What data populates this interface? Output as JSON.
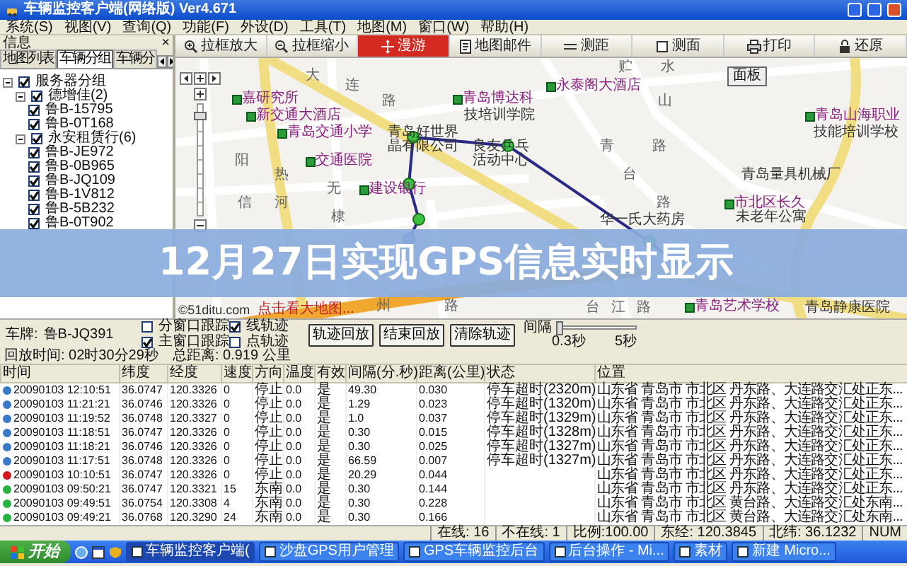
{
  "window": {
    "title": "车辆监控客户端(网络版) Ver4.671"
  },
  "menu": [
    "系统(S)",
    "视图(V)",
    "查询(Q)",
    "功能(F)",
    "外设(D)",
    "工具(T)",
    "地图(M)",
    "窗口(W)",
    "帮助(H)"
  ],
  "info_panel": {
    "title": "信息",
    "close": "×",
    "tabs": [
      {
        "label": "地图列表",
        "selected": false
      },
      {
        "label": "车辆分组",
        "selected": true
      },
      {
        "label": "车辆分",
        "selected": false
      }
    ],
    "tree": [
      {
        "label": "服务器分组",
        "checked": true,
        "expanded": true,
        "children": [
          {
            "label": "德增佳(2)",
            "checked": true,
            "expanded": true,
            "children": [
              {
                "label": "鲁B-15795",
                "checked": true
              },
              {
                "label": "鲁B-0T168",
                "checked": true
              }
            ]
          },
          {
            "label": "永安租赁行(6)",
            "checked": true,
            "expanded": true,
            "children": [
              {
                "label": "鲁B-JE972",
                "checked": true
              },
              {
                "label": "鲁B-0B965",
                "checked": true
              },
              {
                "label": "鲁B-JQ109",
                "checked": true
              },
              {
                "label": "鲁B-1V812",
                "checked": true
              },
              {
                "label": "鲁B-5B232",
                "checked": true
              },
              {
                "label": "鲁B-0T902",
                "checked": true
              }
            ]
          }
        ]
      }
    ]
  },
  "map": {
    "toolbar": [
      {
        "label": "拉框放大",
        "selected": false
      },
      {
        "label": "拉框缩小",
        "selected": false
      },
      {
        "label": "漫游",
        "selected": true
      },
      {
        "label": "地图邮件",
        "selected": false
      },
      {
        "label": "测距",
        "selected": false
      },
      {
        "label": "测面",
        "selected": false
      },
      {
        "label": "打印",
        "selected": false
      },
      {
        "label": "还原",
        "selected": false
      }
    ],
    "panel_button": "面板",
    "labels": [
      {
        "text": "贮",
        "kind": "road"
      },
      {
        "text": "水",
        "kind": "road"
      },
      {
        "text": "大",
        "kind": "road"
      },
      {
        "text": "连",
        "kind": "road"
      },
      {
        "text": "永泰阁大酒店",
        "kind": "poi"
      },
      {
        "text": "嘉研究所",
        "kind": "poi"
      },
      {
        "text": "路",
        "kind": "road"
      },
      {
        "text": "青岛博达科",
        "kind": "poi"
      },
      {
        "text": "山",
        "kind": "road"
      },
      {
        "text": "新交通大酒店",
        "kind": "poi"
      },
      {
        "text": "技培训学院",
        "kind": "text"
      },
      {
        "text": "青岛山海职业",
        "kind": "poi"
      },
      {
        "text": "青岛交通小学",
        "kind": "poi"
      },
      {
        "text": "青岛好世界",
        "kind": "text"
      },
      {
        "text": "技能培训学校",
        "kind": "text"
      },
      {
        "text": "晶有限公司",
        "kind": "text"
      },
      {
        "text": "良友乒乓",
        "kind": "text"
      },
      {
        "text": "青",
        "kind": "road"
      },
      {
        "text": "路",
        "kind": "road"
      },
      {
        "text": "阳",
        "kind": "road"
      },
      {
        "text": "交通医院",
        "kind": "poi"
      },
      {
        "text": "活动中心",
        "kind": "text"
      },
      {
        "text": "热",
        "kind": "road"
      },
      {
        "text": "台",
        "kind": "road"
      },
      {
        "text": "青岛量具机械厂",
        "kind": "text"
      },
      {
        "text": "无",
        "kind": "road"
      },
      {
        "text": "建设银行",
        "kind": "poi"
      },
      {
        "text": "信",
        "kind": "road"
      },
      {
        "text": "河",
        "kind": "road"
      },
      {
        "text": "路",
        "kind": "road"
      },
      {
        "text": "市北区长久",
        "kind": "poi"
      },
      {
        "text": "棣",
        "kind": "road"
      },
      {
        "text": "华一氏大药房",
        "kind": "text"
      },
      {
        "text": "未老年公寓",
        "kind": "text"
      },
      {
        "text": "州",
        "kind": "road"
      },
      {
        "text": "路",
        "kind": "road"
      },
      {
        "text": "台",
        "kind": "road"
      },
      {
        "text": "江",
        "kind": "road"
      },
      {
        "text": "路",
        "kind": "road"
      },
      {
        "text": "青岛艺术学校",
        "kind": "poi"
      },
      {
        "text": "青岛静康医院",
        "kind": "text"
      }
    ],
    "copyright": "©51ditu.com",
    "big_map_link": "点击看大地图..."
  },
  "playback": {
    "plate_label": "车牌:",
    "plate": "鲁B-JQ391",
    "options": [
      {
        "label": "分窗口跟踪",
        "checked": false
      },
      {
        "label": "线轨迹",
        "checked": true
      },
      {
        "label": "主窗口跟踪",
        "checked": true
      },
      {
        "label": "点轨迹",
        "checked": false
      }
    ],
    "buttons": [
      "轨迹回放",
      "结束回放",
      "清除轨迹"
    ],
    "interval": {
      "label": "间隔",
      "level": 0,
      "min": "0.3秒",
      "max": "5秒"
    }
  },
  "summary": [
    "回放时间: 02时30分29秒",
    "总距离: 0.919 公里"
  ],
  "table": {
    "columns": [
      "时间",
      "纬度",
      "经度",
      "速度",
      "方向",
      "温度",
      "有效",
      "间隔(分.秒)",
      "距离(公里)",
      "状态",
      "位置"
    ],
    "rows": [
      {
        "color": "#3a78c8",
        "cells": [
          "20090103 12:10:51",
          "36.0747",
          "120.3326",
          "0",
          "停止",
          "0.0",
          "是",
          "49.30",
          "0.030",
          "停车超时(2320m)",
          "山东省 青岛市 市北区 丹东路、大连路交汇处正东..."
        ]
      },
      {
        "color": "#3a78c8",
        "cells": [
          "20090103 11:21:21",
          "36.0746",
          "120.3326",
          "0",
          "停止",
          "0.0",
          "是",
          "1.29",
          "0.023",
          "停车超时(1320m)",
          "山东省 青岛市 市北区 丹东路、大连路交汇处正东..."
        ]
      },
      {
        "color": "#3a78c8",
        "cells": [
          "20090103 11:19:52",
          "36.0748",
          "120.3327",
          "0",
          "停止",
          "0.0",
          "是",
          "1.0",
          "0.037",
          "停车超时(1329m)",
          "山东省 青岛市 市北区 丹东路、大连路交汇处正东..."
        ]
      },
      {
        "color": "#3a78c8",
        "cells": [
          "20090103 11:18:51",
          "36.0747",
          "120.3326",
          "0",
          "停止",
          "0.0",
          "是",
          "0.30",
          "0.015",
          "停车超时(1328m)",
          "山东省 青岛市 市北区 丹东路、大连路交汇处正东..."
        ]
      },
      {
        "color": "#3a78c8",
        "cells": [
          "20090103 11:18:21",
          "36.0746",
          "120.3326",
          "0",
          "停止",
          "0.0",
          "是",
          "0.30",
          "0.025",
          "停车超时(1327m)",
          "山东省 青岛市 市北区 丹东路、大连路交汇处正东..."
        ]
      },
      {
        "color": "#3a78c8",
        "cells": [
          "20090103 11:17:51",
          "36.0748",
          "120.3326",
          "0",
          "停止",
          "0.0",
          "是",
          "66.59",
          "0.007",
          "停车超时(1327m)",
          "山东省 青岛市 市北区 丹东路、大连路交汇处正东..."
        ]
      },
      {
        "color": "#d01818",
        "cells": [
          "20090103 10:10:51",
          "36.0747",
          "120.3326",
          "0",
          "停止",
          "0.0",
          "是",
          "20.29",
          "0.044",
          null,
          "山东省 青岛市 市北区 丹东路、大连路交汇处正东..."
        ]
      },
      {
        "color": "#28b040",
        "cells": [
          "20090103 09:50:21",
          "36.0747",
          "120.3321",
          "15",
          "东南",
          "0.0",
          "是",
          "0.30",
          "0.144",
          null,
          "山东省 青岛市 市北区 丹东路、大连路交汇处正东..."
        ]
      },
      {
        "color": "#28b040",
        "cells": [
          "20090103 09:49:51",
          "36.0754",
          "120.3308",
          "4",
          "东南",
          "0.0",
          "是",
          "0.30",
          "0.228",
          null,
          "山东省 青岛市 市北区 黄台路、大连路交汇处东南..."
        ]
      },
      {
        "color": "#28b040",
        "cells": [
          "20090103 09:49:21",
          "36.0768",
          "120.3290",
          "24",
          "东南",
          "0.0",
          "是",
          "0.30",
          "0.166",
          null,
          "山东省 青岛市 市北区 黄台路、大连路交汇处东南..."
        ]
      }
    ]
  },
  "status_bar": [
    "在线: 16",
    "不在线: 1",
    "比例:100.00",
    "东经: 120.3845",
    "北纬: 36.1232",
    "NUM"
  ],
  "taskbar": {
    "start": "开始",
    "items": [
      {
        "label": "车辆监控客户端(",
        "selected": true
      },
      {
        "label": "沙盘GPS用户管理",
        "selected": false
      },
      {
        "label": "GPS车辆监控后台",
        "selected": false
      },
      {
        "label": "后台操作 - Mi...",
        "selected": false
      },
      {
        "label": "素材",
        "selected": false
      },
      {
        "label": "新建 Micro...",
        "selected": false
      }
    ]
  },
  "banner": {
    "text": "12月27日实现GPS信息实时显示"
  }
}
